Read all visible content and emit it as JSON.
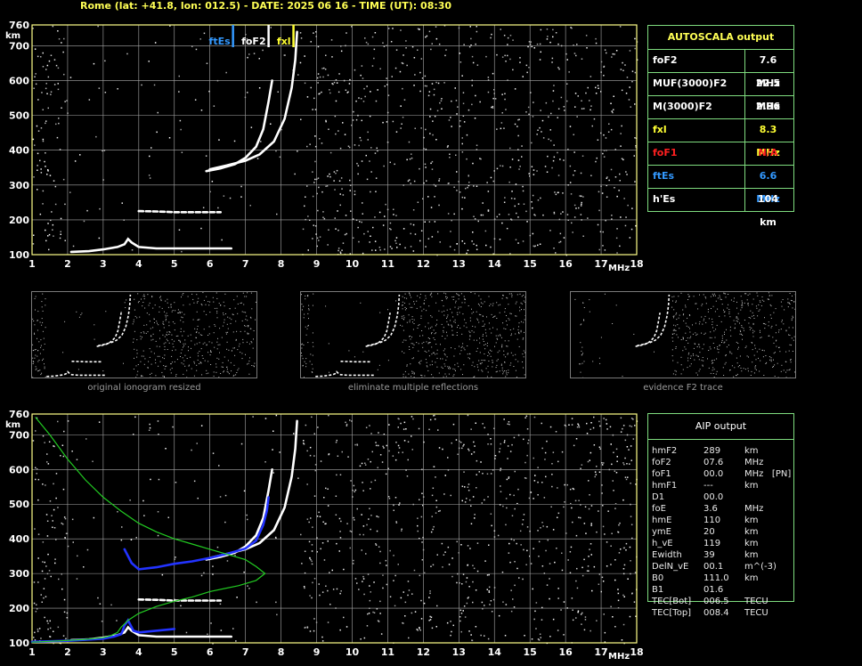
{
  "header": {
    "title": "Rome (lat: +41.8, lon: 012.5) - DATE: 2025 06 16 - TIME (UT): 08:30"
  },
  "colors": {
    "grid": "#a9a9a9",
    "frame": "#ffff88",
    "trace": "#ffffff",
    "blue": "#2233ff",
    "green": "#22cc22",
    "yellow": "#ffff33",
    "red": "#ff2020",
    "ftes": "#3399ff"
  },
  "chart_data": [
    {
      "type": "scatter",
      "title": "",
      "xlabel": "MHz",
      "ylabel": "km",
      "xlim": [
        1,
        18
      ],
      "ylim": [
        100,
        760
      ],
      "x_ticks": [
        "1",
        "2",
        "3",
        "4",
        "5",
        "6",
        "7",
        "8",
        "9",
        "10",
        "11",
        "12",
        "13",
        "14",
        "15",
        "16",
        "17",
        "18"
      ],
      "y_ticks": [
        "100",
        "200",
        "300",
        "400",
        "500",
        "600",
        "700",
        "760"
      ],
      "markers": [
        {
          "label": "ftEs",
          "x": 6.6,
          "color": "#3399ff"
        },
        {
          "label": "foF2",
          "x": 7.6,
          "color": "#ffffff"
        },
        {
          "label": "fxl",
          "x": 8.3,
          "color": "#ffff33"
        }
      ],
      "series": [
        {
          "color": "#ffffff",
          "points": [
            [
              2.1,
              108
            ],
            [
              2.6,
              110
            ],
            [
              3.0,
              115
            ],
            [
              3.4,
              122
            ],
            [
              3.6,
              130
            ],
            [
              3.7,
              145
            ],
            [
              3.8,
              135
            ],
            [
              4.0,
              122
            ],
            [
              4.5,
              118
            ],
            [
              5.0,
              118
            ],
            [
              5.5,
              118
            ],
            [
              6.0,
              118
            ],
            [
              6.6,
              118
            ]
          ]
        },
        {
          "color": "#ffffff",
          "points": [
            [
              4.0,
              225
            ],
            [
              4.5,
              224
            ],
            [
              5.0,
              222
            ],
            [
              5.5,
              222
            ],
            [
              6.0,
              222
            ],
            [
              6.3,
              222
            ]
          ]
        },
        {
          "color": "#ffffff",
          "points": [
            [
              5.9,
              340
            ],
            [
              6.3,
              348
            ],
            [
              6.7,
              360
            ],
            [
              7.0,
              378
            ],
            [
              7.3,
              410
            ],
            [
              7.5,
              460
            ],
            [
              7.65,
              540
            ],
            [
              7.75,
              600
            ]
          ]
        },
        {
          "color": "#ffffff",
          "points": [
            [
              6.0,
              345
            ],
            [
              6.5,
              357
            ],
            [
              7.0,
              370
            ],
            [
              7.4,
              388
            ],
            [
              7.8,
              425
            ],
            [
              8.1,
              490
            ],
            [
              8.3,
              580
            ],
            [
              8.4,
              660
            ],
            [
              8.45,
              740
            ]
          ]
        }
      ]
    },
    {
      "type": "scatter",
      "title": "",
      "xlabel": "MHz",
      "ylabel": "km",
      "xlim": [
        1,
        18
      ],
      "ylim": [
        100,
        760
      ],
      "x_ticks": [
        "1",
        "2",
        "3",
        "4",
        "5",
        "6",
        "7",
        "8",
        "9",
        "10",
        "11",
        "12",
        "13",
        "14",
        "15",
        "16",
        "17",
        "18"
      ],
      "y_ticks": [
        "100",
        "200",
        "300",
        "400",
        "500",
        "600",
        "700",
        "760"
      ],
      "series": [
        {
          "color": "#ffffff",
          "points": [
            [
              2.1,
              108
            ],
            [
              2.6,
              110
            ],
            [
              3.0,
              115
            ],
            [
              3.4,
              122
            ],
            [
              3.6,
              130
            ],
            [
              3.7,
              145
            ],
            [
              3.8,
              135
            ],
            [
              4.0,
              122
            ],
            [
              4.5,
              118
            ],
            [
              5.0,
              118
            ],
            [
              5.5,
              118
            ],
            [
              6.0,
              118
            ],
            [
              6.6,
              118
            ]
          ]
        },
        {
          "color": "#ffffff",
          "points": [
            [
              4.0,
              225
            ],
            [
              4.5,
              224
            ],
            [
              5.0,
              222
            ],
            [
              5.5,
              222
            ],
            [
              6.0,
              222
            ],
            [
              6.3,
              222
            ]
          ]
        },
        {
          "color": "#ffffff",
          "points": [
            [
              5.9,
              340
            ],
            [
              6.3,
              348
            ],
            [
              6.7,
              360
            ],
            [
              7.0,
              378
            ],
            [
              7.3,
              410
            ],
            [
              7.5,
              460
            ],
            [
              7.65,
              540
            ],
            [
              7.75,
              600
            ]
          ]
        },
        {
          "color": "#ffffff",
          "points": [
            [
              6.0,
              345
            ],
            [
              6.5,
              357
            ],
            [
              7.0,
              370
            ],
            [
              7.4,
              388
            ],
            [
              7.8,
              425
            ],
            [
              8.1,
              490
            ],
            [
              8.3,
              580
            ],
            [
              8.4,
              660
            ],
            [
              8.45,
              740
            ]
          ]
        },
        {
          "color": "#2233ff",
          "points": [
            [
              1.0,
              103
            ],
            [
              2.0,
              106
            ],
            [
              3.0,
              112
            ],
            [
              3.3,
              118
            ],
            [
              3.5,
              125
            ],
            [
              3.55,
              135
            ],
            [
              3.6,
              150
            ],
            [
              3.7,
              165
            ],
            [
              3.75,
              155
            ],
            [
              3.8,
              145
            ],
            [
              3.85,
              135
            ],
            [
              4.0,
              130
            ],
            [
              5.0,
              140
            ]
          ]
        },
        {
          "color": "#2233ff",
          "points": [
            [
              3.6,
              370
            ],
            [
              3.8,
              330
            ],
            [
              4.0,
              312
            ],
            [
              4.5,
              318
            ],
            [
              5.0,
              328
            ],
            [
              5.5,
              335
            ],
            [
              6.0,
              345
            ],
            [
              6.5,
              357
            ],
            [
              7.0,
              372
            ],
            [
              7.3,
              395
            ],
            [
              7.5,
              440
            ],
            [
              7.6,
              480
            ],
            [
              7.65,
              520
            ]
          ]
        },
        {
          "color": "#22cc22",
          "points": [
            [
              1.1,
              750
            ],
            [
              1.5,
              700
            ],
            [
              2.0,
              630
            ],
            [
              2.5,
              570
            ],
            [
              3.0,
              520
            ],
            [
              3.5,
              480
            ],
            [
              4.0,
              445
            ],
            [
              4.5,
              420
            ],
            [
              5.0,
              400
            ],
            [
              5.5,
              385
            ],
            [
              6.0,
              370
            ],
            [
              6.5,
              355
            ],
            [
              7.0,
              340
            ],
            [
              7.3,
              320
            ],
            [
              7.55,
              300
            ],
            [
              7.3,
              280
            ],
            [
              6.8,
              265
            ],
            [
              6.0,
              248
            ],
            [
              5.5,
              232
            ],
            [
              5.0,
              220
            ],
            [
              4.5,
              205
            ],
            [
              4.0,
              185
            ],
            [
              3.7,
              165
            ],
            [
              3.5,
              145
            ],
            [
              3.4,
              130
            ],
            [
              3.2,
              120
            ],
            [
              3.0,
              115
            ],
            [
              2.5,
              110
            ],
            [
              2.0,
              107
            ],
            [
              1.0,
              102
            ]
          ]
        }
      ]
    }
  ],
  "autoscala": {
    "title": "AUTOSCALA output",
    "rows": [
      {
        "label": "foF2",
        "value": "7.6 MHz",
        "color": "#ffffff"
      },
      {
        "label": "MUF(3000)F2",
        "value": "22.5 MHz",
        "color": "#ffffff"
      },
      {
        "label": "M(3000)F2",
        "value": "2.96",
        "color": "#ffffff"
      },
      {
        "label": "fxl",
        "value": "8.3 MHz",
        "color": "#ffff33"
      },
      {
        "label": "foF1",
        "value": "N/A",
        "color": "#ff2020"
      },
      {
        "label": "ftEs",
        "value": "6.6 MHz",
        "color": "#3399ff"
      },
      {
        "label": "h'Es",
        "value": "104    km",
        "color": "#ffffff"
      }
    ]
  },
  "aip": {
    "title": "AIP output",
    "rows": [
      [
        "hmF2",
        "289",
        "km"
      ],
      [
        "foF2",
        "07.6",
        "MHz"
      ],
      [
        "foF1",
        "00.0",
        "MHz   [PN]"
      ],
      [
        "hmF1",
        "---",
        "km"
      ],
      [
        "D1",
        "00.0",
        ""
      ],
      [
        "foE",
        "3.6",
        "MHz"
      ],
      [
        "hmE",
        "110",
        "km"
      ],
      [
        "ymE",
        "20",
        "km"
      ],
      [
        "h_vE",
        "119",
        "km"
      ],
      [
        "Ewidth",
        "39",
        "km"
      ],
      [
        "DelN_vE",
        "00.1",
        "m^(-3)"
      ],
      [
        "B0",
        "111.0",
        "km"
      ],
      [
        "B1",
        "01.6",
        ""
      ],
      [
        "TEC[Bot]",
        "006.5",
        "TECU"
      ],
      [
        "TEC[Top]",
        "008.4",
        "TECU"
      ]
    ]
  },
  "thumbnails": [
    {
      "caption": "original ionogram resized"
    },
    {
      "caption": "eliminate multiple reflections"
    },
    {
      "caption": "evidence F2 trace"
    }
  ]
}
